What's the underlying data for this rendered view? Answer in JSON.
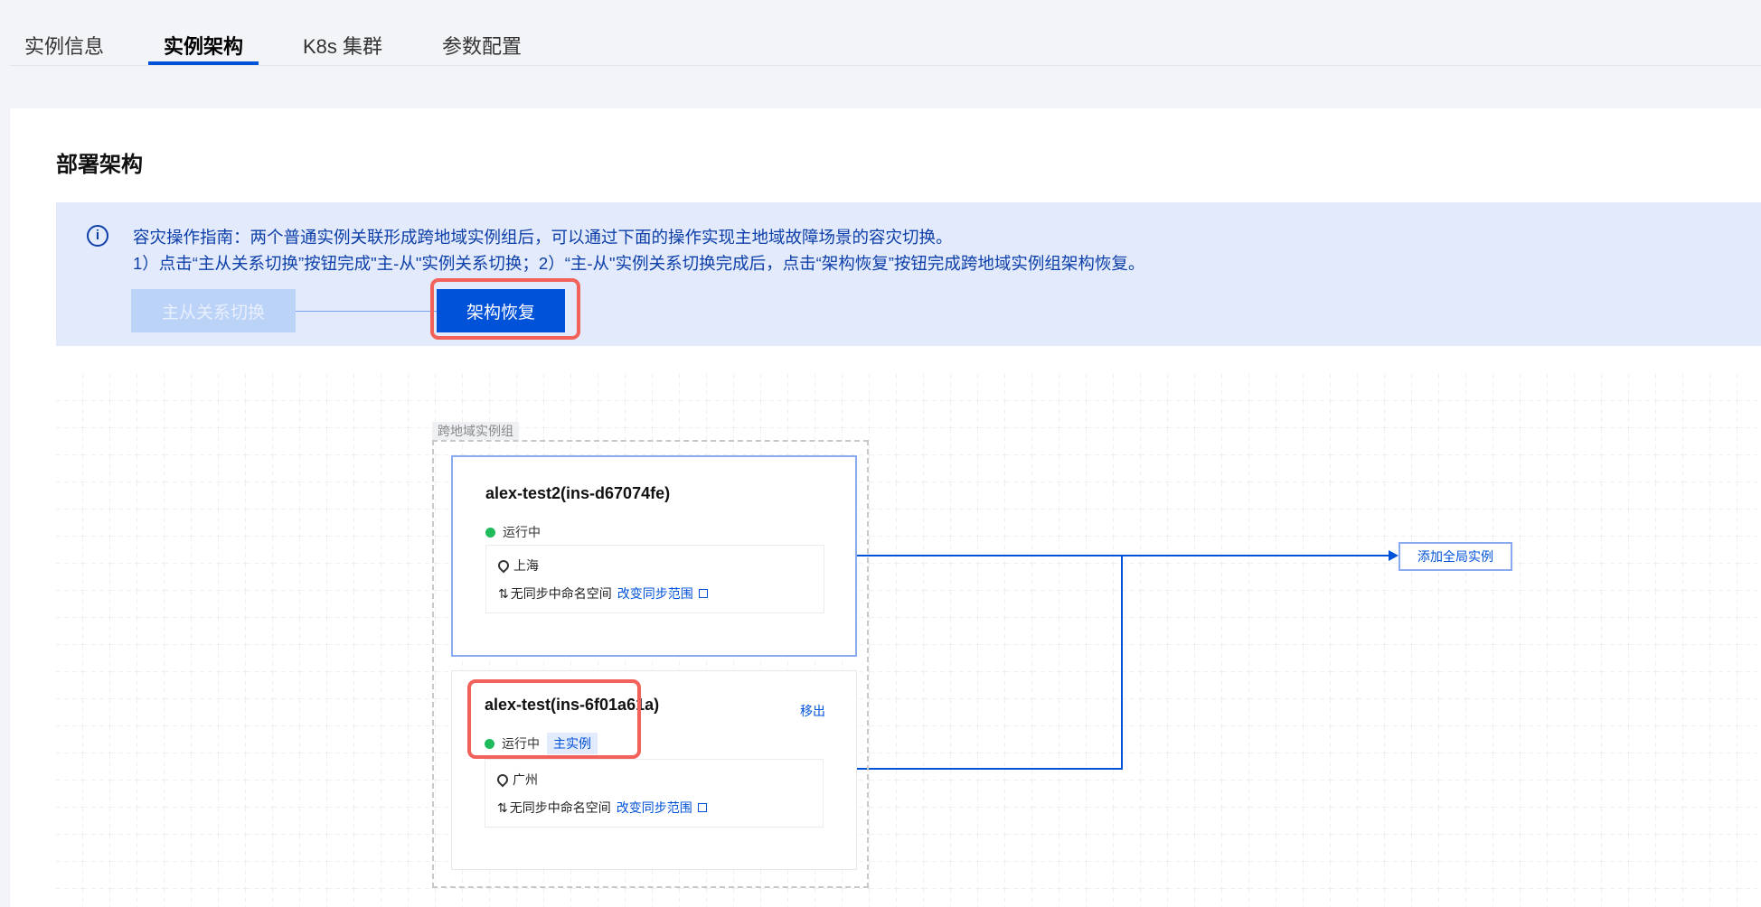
{
  "tabs": [
    {
      "label": "实例信息",
      "active": false
    },
    {
      "label": "实例架构",
      "active": true
    },
    {
      "label": "K8s 集群",
      "active": false
    },
    {
      "label": "参数配置",
      "active": false
    }
  ],
  "section_title": "部署架构",
  "alert": {
    "icon": "info-icon",
    "line1": "容灾操作指南：两个普通实例关联形成跨地域实例组后，可以通过下面的操作实现主地域故障场景的容灾切换。",
    "line2": "1）点击“主从关系切换”按钮完成\"主-从\"实例关系切换；2）“主-从\"实例关系切换完成后，点击“架构恢复”按钮完成跨地域实例组架构恢复。",
    "switch_button": "主从关系切换",
    "restore_button": "架构恢复"
  },
  "group": {
    "label": "跨地域实例组",
    "instances": [
      {
        "title": "alex-test2(ins-d67074fe)",
        "status": "运行中",
        "region": "上海",
        "sync_text": "无同步中命名空间",
        "sync_link": "改变同步范围"
      },
      {
        "title": "alex-test(ins-6f01a61a)",
        "status": "运行中",
        "badge": "主实例",
        "action": "移出",
        "region": "广州",
        "sync_text": "无同步中命名空间",
        "sync_link": "改变同步范围"
      }
    ]
  },
  "add_global": "添加全局实例",
  "colors": {
    "primary": "#0052d9",
    "running": "#1fba5c",
    "highlight": "#f2615a"
  }
}
